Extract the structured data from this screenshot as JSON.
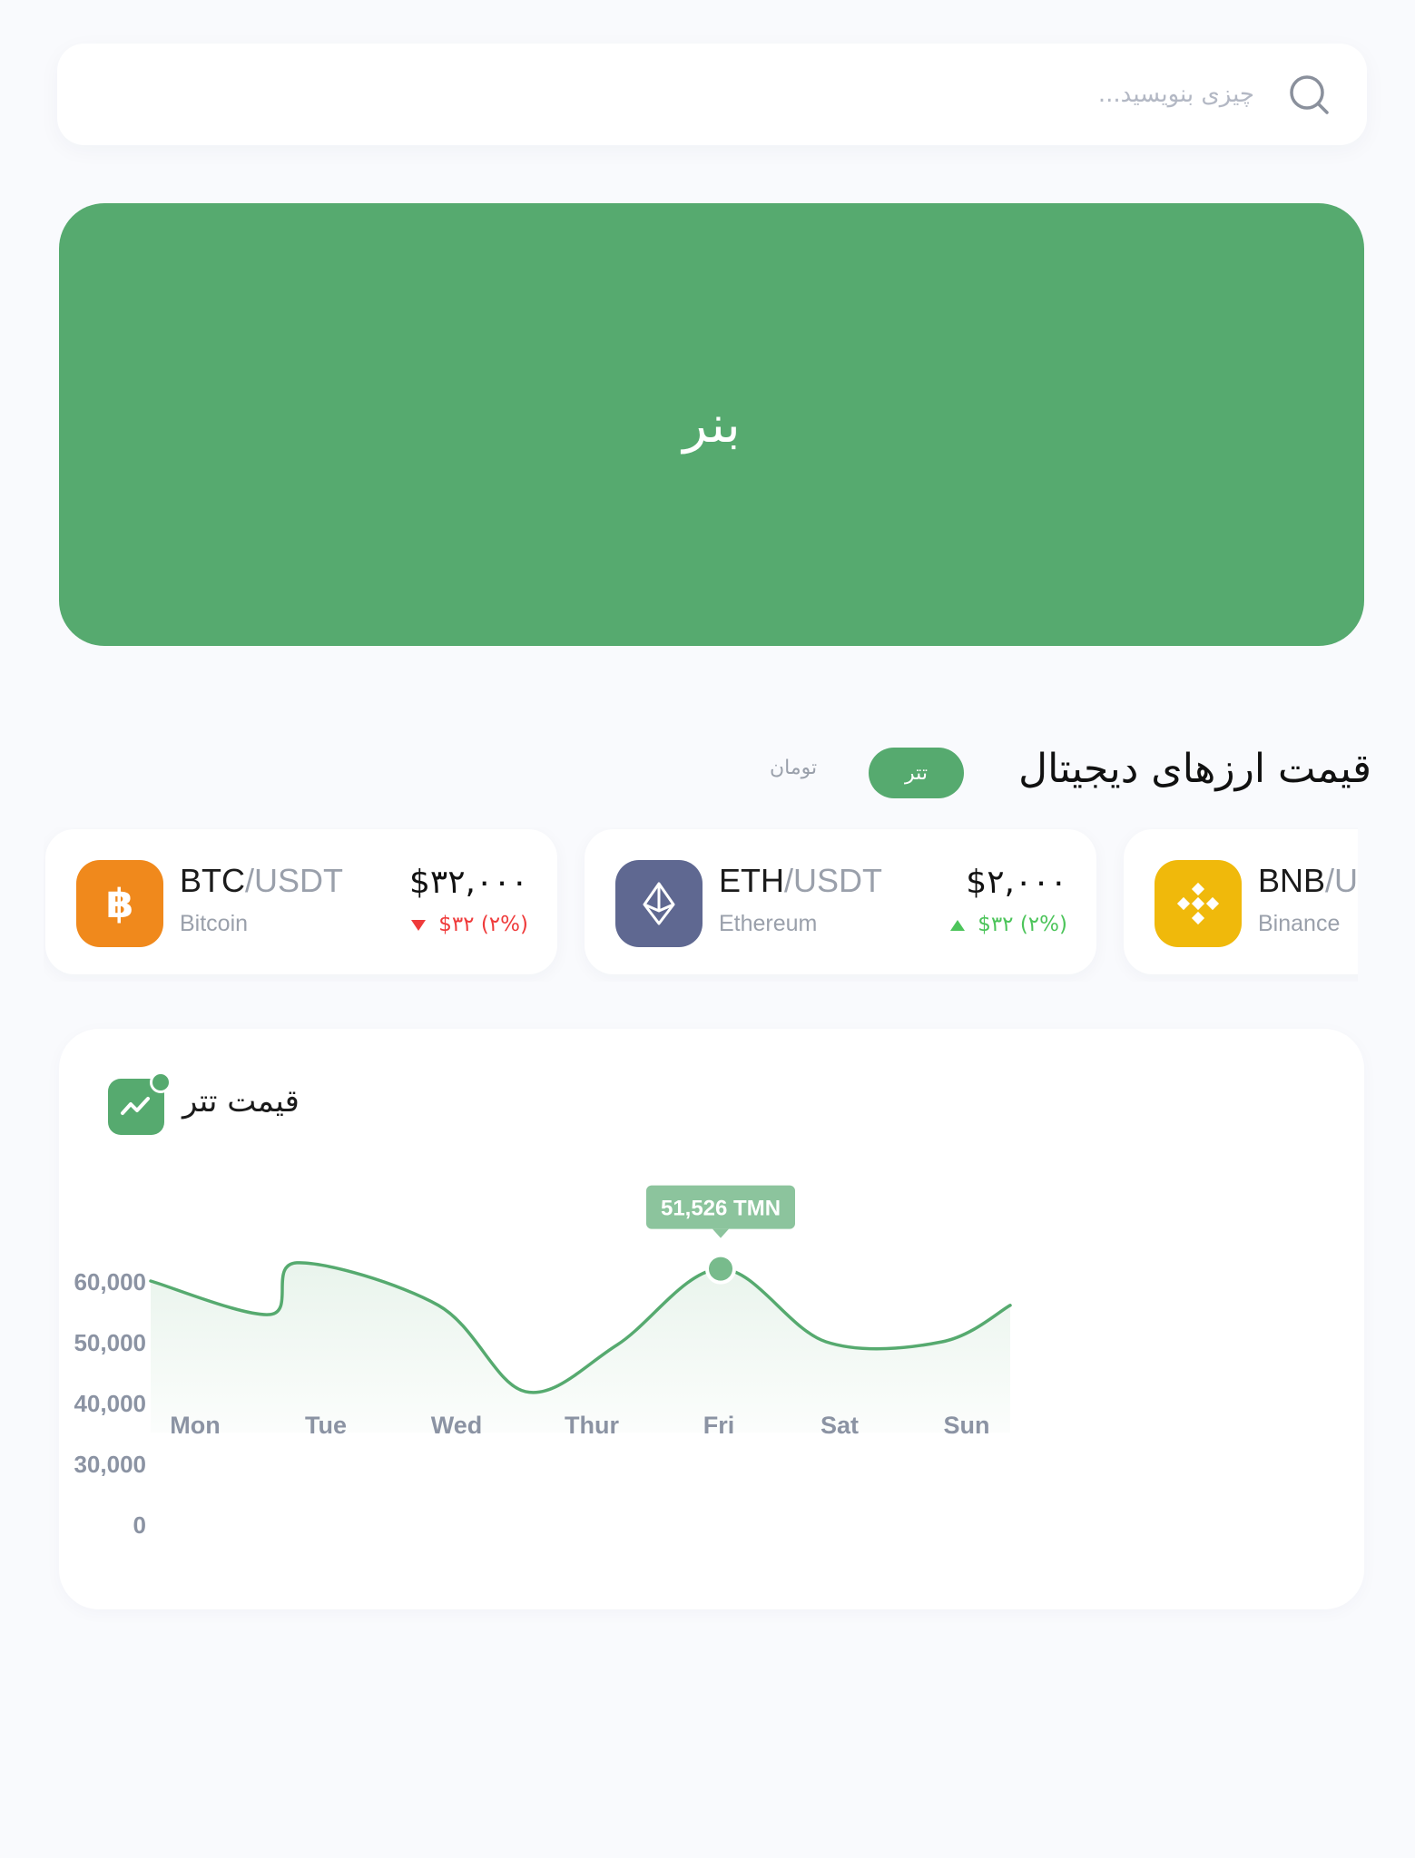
{
  "search": {
    "placeholder": "چیزی بنویسید..."
  },
  "banner": {
    "label": "بنر"
  },
  "prices_section": {
    "title": "قیمت ارزهای دیجیتال",
    "toggle_active": "تتر",
    "toggle_inactive": "تومان"
  },
  "coins": [
    {
      "base": "BTC",
      "quote": "/USDT",
      "name": "Bitcoin",
      "price": "$۳۲,۰۰۰",
      "change": "$۳۲ (۲%)",
      "direction": "down",
      "icon": "bitcoin-icon",
      "color": "#f0891c"
    },
    {
      "base": "ETH",
      "quote": "/USDT",
      "name": "Ethereum",
      "price": "$۲,۰۰۰",
      "change": "$۳۲ (۲%)",
      "direction": "up",
      "icon": "ethereum-icon",
      "color": "#5f6891"
    },
    {
      "base": "BNB",
      "quote": "/USDT",
      "name": "Binance",
      "price": "",
      "change": "",
      "direction": "",
      "icon": "binance-icon",
      "color": "#f0b90b"
    }
  ],
  "colors": {
    "accent": "#56aa6f",
    "down": "#ef3b3b",
    "up": "#4cc45a"
  },
  "chart_card": {
    "title": "قیمت تتر",
    "icon": "trend-chart-icon"
  },
  "chart_data": {
    "type": "area",
    "title": "",
    "xlabel": "",
    "ylabel": "",
    "categories": [
      "Mon",
      "Tue",
      "Wed",
      "Thur",
      "Fri",
      "Sat",
      "Sun"
    ],
    "y_ticks": [
      "60,000",
      "50,000",
      "40,000",
      "30,000",
      "0"
    ],
    "tooltip": {
      "category": "Fri",
      "value": 51526,
      "label": "51,526 TMN"
    },
    "series": [
      {
        "points": [
          {
            "x": "Mon",
            "y": 60000
          },
          {
            "x": "Tue",
            "y": 54500
          },
          {
            "x": "Tue",
            "y": 63000
          },
          {
            "x": "Wed",
            "y": 56000
          },
          {
            "x": "Wed",
            "y": 41800
          },
          {
            "x": "Thur",
            "y": 49500
          },
          {
            "x": "Fri",
            "y": 62000
          },
          {
            "x": "Sat",
            "y": 50000
          },
          {
            "x": "Sun",
            "y": 50000
          },
          {
            "x": "Sun",
            "y": 56000
          }
        ]
      }
    ]
  }
}
